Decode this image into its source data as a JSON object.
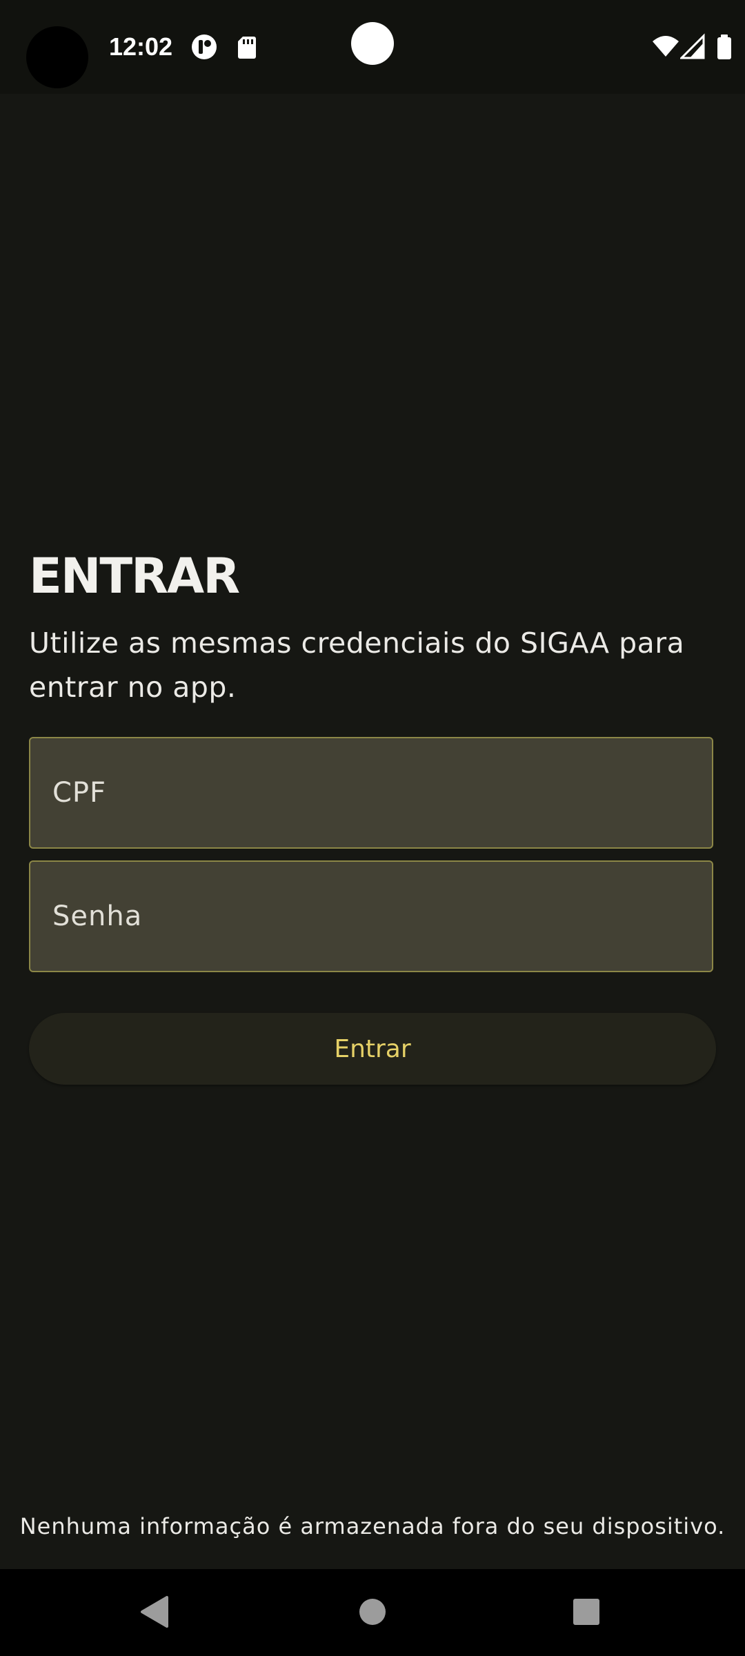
{
  "status_bar": {
    "time": "12:02",
    "icons": [
      "camera-cutout",
      "notification-app-icon",
      "sd-card-icon",
      "wifi-icon",
      "cell-signal-icon",
      "battery-icon"
    ]
  },
  "login": {
    "title": "ENTRAR",
    "subtitle": "Utilize as mesmas credenciais do SIGAA para entrar no app.",
    "cpf_placeholder": "CPF",
    "password_placeholder": "Senha",
    "submit_label": "Entrar",
    "footer_note": "Nenhuma informação é armazenada fora do seu dispositivo."
  },
  "nav_bar": {
    "icons": [
      "back-icon",
      "home-icon",
      "recents-icon"
    ]
  },
  "colors": {
    "background": "#161713",
    "field_fill": "#434134",
    "field_border": "#8c8747",
    "button_fill": "#23231a",
    "accent_text": "#e6d167"
  }
}
